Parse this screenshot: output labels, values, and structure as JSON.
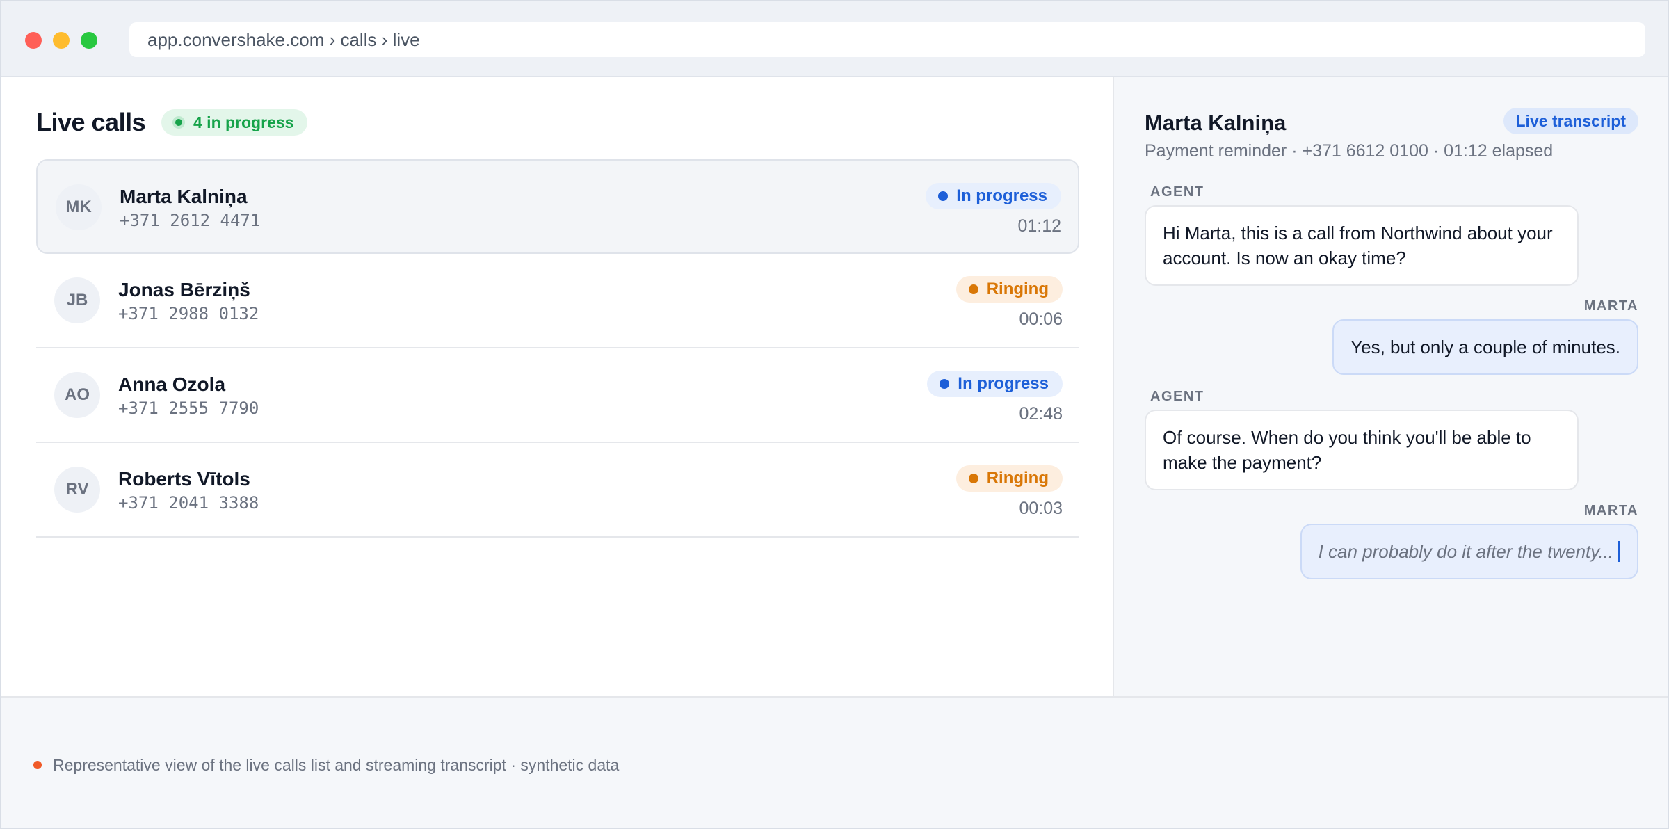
{
  "browser": {
    "url": "app.convershake.com › calls › live"
  },
  "calls": {
    "title": "Live calls",
    "count_label": "4 in progress",
    "items": [
      {
        "initials": "MK",
        "name": "Marta Kalniņa",
        "phone": "+371 2612 4471",
        "status": "In progress",
        "status_kind": "inprogress",
        "duration": "01:12",
        "selected": true
      },
      {
        "initials": "JB",
        "name": "Jonas Bērziņš",
        "phone": "+371 2988 0132",
        "status": "Ringing",
        "status_kind": "ringing",
        "duration": "00:06",
        "selected": false
      },
      {
        "initials": "AO",
        "name": "Anna Ozola",
        "phone": "+371 2555 7790",
        "status": "In progress",
        "status_kind": "inprogress",
        "duration": "02:48",
        "selected": false
      },
      {
        "initials": "RV",
        "name": "Roberts Vītols",
        "phone": "+371 2041 3388",
        "status": "Ringing",
        "status_kind": "ringing",
        "duration": "00:03",
        "selected": false
      }
    ]
  },
  "transcript": {
    "name": "Marta Kalniņa",
    "meta": "Payment reminder · +371 6612 0100 · 01:12 elapsed",
    "badge": "Live transcript",
    "messages": [
      {
        "speaker": "AGENT",
        "text": "Hi Marta, this is a call from Northwind about your account. Is now an okay time?"
      },
      {
        "speaker": "MARTA",
        "text": "Yes, but only a couple of minutes."
      },
      {
        "speaker": "AGENT",
        "text": "Of course. When do you think you'll be able to make the payment?"
      },
      {
        "speaker": "MARTA",
        "text": "I can probably do it after the twenty...",
        "streaming": true
      }
    ]
  },
  "footer": {
    "text": "Representative view of the live calls list and streaming transcript · synthetic data"
  },
  "colors": {
    "accent_blue": "#1d5fd8",
    "ringing_orange": "#d97706",
    "success_green": "#16a34a",
    "footer_dot": "#f05a28"
  }
}
